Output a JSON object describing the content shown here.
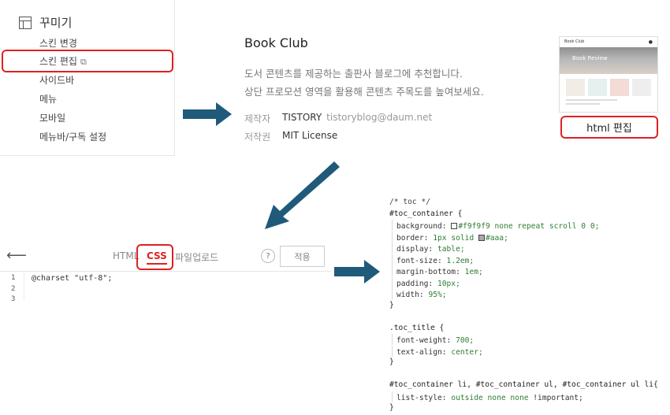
{
  "sidebar": {
    "heading": "꾸미기",
    "items": [
      {
        "label": "스킨 변경"
      },
      {
        "label": "스킨 편집",
        "external_icon": "external-link-icon"
      },
      {
        "label": "사이드바"
      },
      {
        "label": "메뉴"
      },
      {
        "label": "모바일"
      },
      {
        "label": "메뉴바/구독 설정"
      }
    ]
  },
  "skin": {
    "title": "Book Club",
    "desc_line1": "도서 콘텐츠를 제공하는 출판사 블로그에 추천합니다.",
    "desc_line2": "상단 프로모션 영역을 활용해 콘텐츠 주목도를 높여보세요.",
    "author_label": "제작자",
    "author_value": "TISTORY",
    "author_email": "tistoryblog@daum.net",
    "license_label": "저작권",
    "license_value": "MIT License",
    "thumbnail": {
      "site_name": "Book Club",
      "hero_text": "Book Review"
    },
    "html_edit_label": "html 편집"
  },
  "editor": {
    "back_icon": "arrow-left-icon",
    "tabs": [
      {
        "label": "HTML",
        "active": false
      },
      {
        "label": "CSS",
        "active": true
      },
      {
        "label": "파일업로드",
        "active": false
      }
    ],
    "help_label": "?",
    "apply_label": "적용",
    "line_numbers": [
      "1",
      "2",
      "3"
    ],
    "code_line1": "@charset \"utf-8\";"
  },
  "css_code": {
    "comment": "/* toc */",
    "sel1": "#toc_container {",
    "p_background": "background: ",
    "v_background": "#f9f9f9 none repeat scroll 0 0;",
    "p_border": "border: ",
    "v_border": "1px solid ",
    "v_border2": "#aaa;",
    "p_display": "display: ",
    "v_display": "table;",
    "p_fontsize": "font-size: ",
    "v_fontsize": "1.2em;",
    "p_marginb": "margin-bottom: ",
    "v_marginb": "1em;",
    "p_padding": "padding: ",
    "v_padding": "10px;",
    "p_width": "width: ",
    "v_width": "95%;",
    "close1": "}",
    "sel2": ".toc_title {",
    "p_fw": "font-weight: ",
    "v_fw": "700;",
    "p_ta": "text-align: ",
    "v_ta": "center;",
    "close2": "}",
    "sel3": "#toc_container li, #toc_container ul, #toc_container ul li{",
    "p_ls": "list-style: ",
    "v_ls": "outside none none ",
    "v_imp": "!important;",
    "close3": "}",
    "swatch1": "#f9f9f9",
    "swatch2": "#aaaaaa"
  },
  "colors": {
    "arrow": "#1f5a7a",
    "highlight": "#e02020",
    "css_value": "#2e7d32"
  }
}
